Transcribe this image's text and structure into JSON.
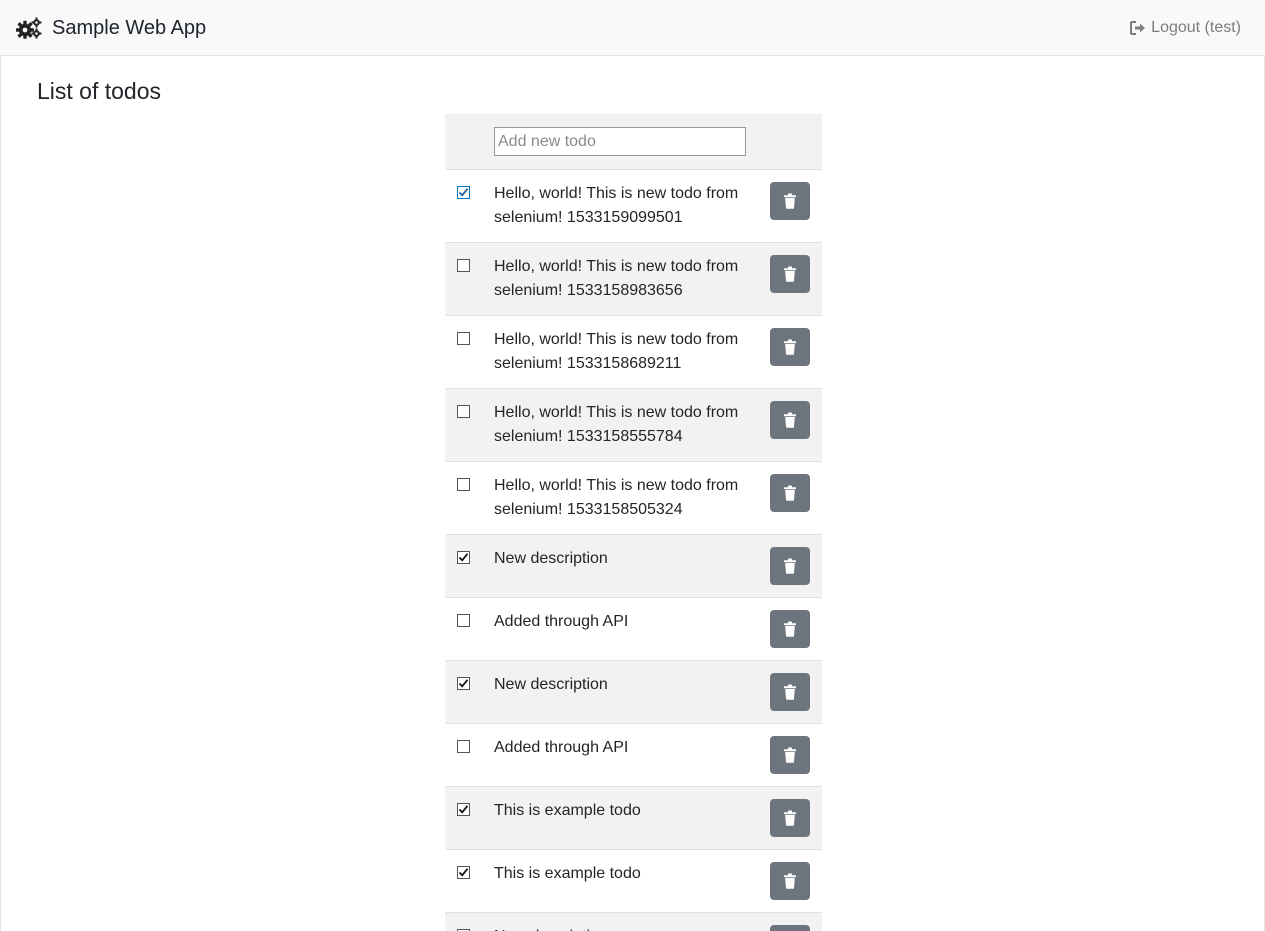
{
  "navbar": {
    "brand_icon": "cogs-icon",
    "brand_label": "Sample Web App",
    "logout_icon": "sign-out-icon",
    "logout_label": "Logout (test)"
  },
  "main": {
    "title": "List of todos",
    "add_placeholder": "Add new todo",
    "delete_icon": "trash-icon",
    "todos": [
      {
        "text": "Hello, world! This is new todo from selenium! 1533159099501",
        "done": true
      },
      {
        "text": "Hello, world! This is new todo from selenium! 1533158983656",
        "done": false
      },
      {
        "text": "Hello, world! This is new todo from selenium! 1533158689211",
        "done": false
      },
      {
        "text": "Hello, world! This is new todo from selenium! 1533158555784",
        "done": false
      },
      {
        "text": "Hello, world! This is new todo from selenium! 1533158505324",
        "done": false
      },
      {
        "text": "New description",
        "done": true
      },
      {
        "text": "Added through API",
        "done": false
      },
      {
        "text": "New description",
        "done": true
      },
      {
        "text": "Added through API",
        "done": false
      },
      {
        "text": "This is example todo",
        "done": true
      },
      {
        "text": "This is example todo",
        "done": true
      },
      {
        "text": "New description",
        "done": false
      }
    ]
  },
  "colors": {
    "navbar_bg": "#f8f9fa",
    "stripe_bg": "#f2f2f2",
    "delete_button": "#6c757d",
    "muted_link": "#7d7d7d"
  }
}
